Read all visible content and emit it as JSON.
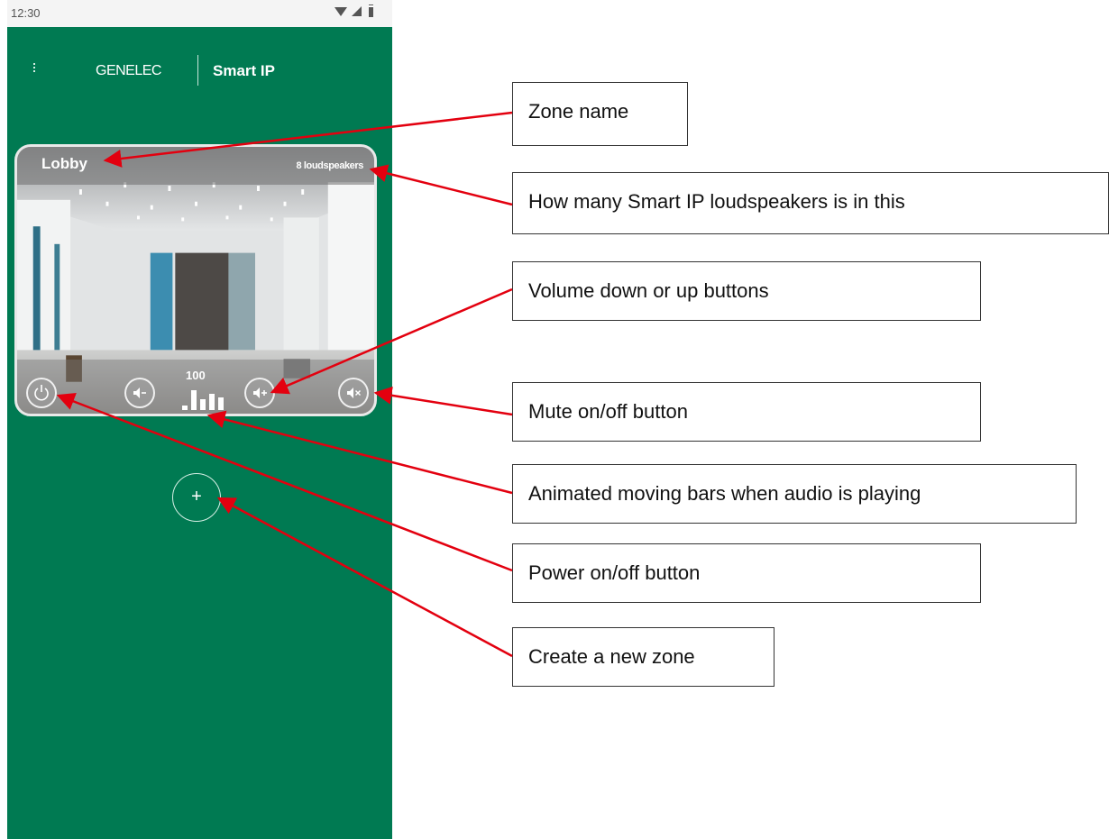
{
  "statusbar": {
    "time": "12:30",
    "icons": [
      "wifi-icon",
      "signal-icon",
      "battery-icon"
    ]
  },
  "app": {
    "brand": {
      "company": "GENELEC",
      "product": "Smart IP"
    },
    "background_color": "#007a52"
  },
  "zone": {
    "name": "Lobby",
    "speaker_count": "8 loudspeakers",
    "volume": "100",
    "controls": [
      "power-icon",
      "volume-down-icon",
      "volume-up-icon",
      "mute-icon"
    ]
  },
  "add_zone": {
    "icon": "plus-icon",
    "label": "+"
  },
  "annotations": [
    {
      "id": "zone-name",
      "text": "Zone name"
    },
    {
      "id": "speaker-count",
      "text": "How many Smart IP loudspeakers is in this"
    },
    {
      "id": "volume-buttons",
      "text": "Volume down or up buttons"
    },
    {
      "id": "mute-button",
      "text": "Mute on/off button"
    },
    {
      "id": "animated-bars",
      "text": "Animated moving bars when audio is playing"
    },
    {
      "id": "power-button",
      "text": "Power on/off button"
    },
    {
      "id": "create-zone",
      "text": "Create a new zone"
    }
  ],
  "arrow_color": "#e3000f"
}
